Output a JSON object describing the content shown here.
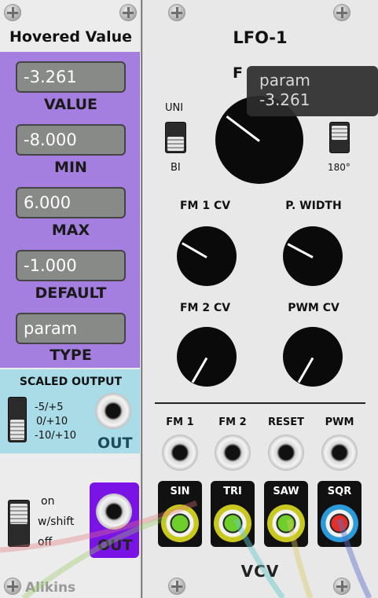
{
  "hovered_value": {
    "title": "Hovered Value",
    "value": {
      "text": "-3.261",
      "label": "VALUE"
    },
    "min": {
      "text": "-8.000",
      "label": "MIN"
    },
    "max": {
      "text": "6.000",
      "label": "MAX"
    },
    "default": {
      "text": "-1.000",
      "label": "DEFAULT"
    },
    "type": {
      "text": "param",
      "label": "TYPE"
    },
    "scaled_output": {
      "title": "SCALED OUTPUT",
      "ranges": [
        "-5/+5",
        "0/+10",
        "-10/+10"
      ],
      "out_label": "OUT"
    },
    "mode_switch": [
      "on",
      "w/shift",
      "off"
    ],
    "out2_label": "OUT",
    "brand": "Alikins",
    "colors": {
      "purple": "#a47fe0",
      "blue": "#a9dce7",
      "out_purple": "#7a14e6"
    }
  },
  "lfo": {
    "title": "LFO-1",
    "freq_label_partial": "F",
    "uni_label": "UNI",
    "bi_label": "BI",
    "phase_label": "180°",
    "knobs": [
      {
        "label": "FM 1 CV"
      },
      {
        "label": "P. WIDTH"
      },
      {
        "label": "FM 2 CV"
      },
      {
        "label": "PWM CV"
      }
    ],
    "inputs": [
      "FM 1",
      "FM 2",
      "RESET",
      "PWM"
    ],
    "outputs": [
      {
        "label": "SIN",
        "ring": "#c8c81e",
        "light": "#6fcf2a"
      },
      {
        "label": "TRI",
        "ring": "#c8c81e",
        "light": "#6fcf2a"
      },
      {
        "label": "SAW",
        "ring": "#c8c81e",
        "light": "#6fcf2a"
      },
      {
        "label": "SQR",
        "ring": "#2a9ad8",
        "light": "#e5302a"
      }
    ],
    "logo": "VCV"
  },
  "tooltip": {
    "name": "param",
    "value": "-3.261"
  }
}
